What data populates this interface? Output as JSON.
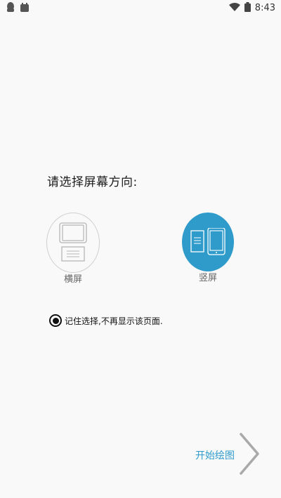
{
  "status_bar": {
    "time": "8:43",
    "icons_left": [
      "qq-icon",
      "app-icon"
    ],
    "icons_right": [
      "wifi-icon",
      "battery-icon"
    ]
  },
  "prompt": "请选择屏幕方向:",
  "orientations": [
    {
      "label": "横屏",
      "selected": false
    },
    {
      "label": "竖屏",
      "selected": true
    }
  ],
  "remember": {
    "text": "记住选择,不再显示该页面.",
    "checked": true
  },
  "start": {
    "label": "开始绘图"
  },
  "colors": {
    "accent": "#2f9bcb",
    "background": "#f8f9f8"
  }
}
